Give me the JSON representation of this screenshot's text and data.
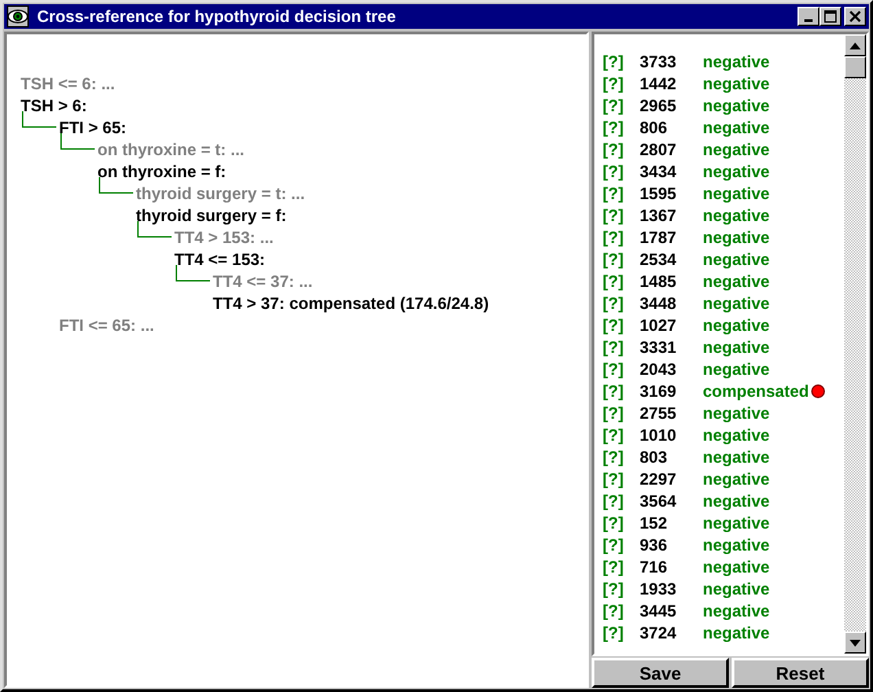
{
  "window": {
    "title": "Cross-reference for hypothyroid decision tree"
  },
  "tree": [
    {
      "text": "TSH <= 6: ...",
      "kind": "collapsed"
    },
    {
      "text": "TSH > 6:",
      "kind": "open",
      "children": [
        {
          "text": "FTI > 65:",
          "kind": "open",
          "children": [
            {
              "text": "on thyroxine = t: ...",
              "kind": "collapsed"
            },
            {
              "text": "on thyroxine = f:",
              "kind": "open",
              "children": [
                {
                  "text": "thyroid surgery = t: ...",
                  "kind": "collapsed"
                },
                {
                  "text": "thyroid surgery = f:",
                  "kind": "open",
                  "children": [
                    {
                      "text": "TT4 > 153: ...",
                      "kind": "collapsed"
                    },
                    {
                      "text": "TT4 <= 153:",
                      "kind": "open",
                      "children": [
                        {
                          "text": "TT4 <= 37: ...",
                          "kind": "collapsed"
                        },
                        {
                          "text": "TT4 > 37: compensated (174.6/24.8)",
                          "kind": "leaf"
                        }
                      ]
                    }
                  ]
                }
              ]
            }
          ]
        },
        {
          "text": "FTI <= 65: ...",
          "kind": "collapsed"
        }
      ]
    }
  ],
  "cases": [
    {
      "mark": "[?]",
      "id": "3733",
      "class": "negative",
      "flagged": false
    },
    {
      "mark": "[?]",
      "id": "1442",
      "class": "negative",
      "flagged": false
    },
    {
      "mark": "[?]",
      "id": "2965",
      "class": "negative",
      "flagged": false
    },
    {
      "mark": "[?]",
      "id": "806",
      "class": "negative",
      "flagged": false
    },
    {
      "mark": "[?]",
      "id": "2807",
      "class": "negative",
      "flagged": false
    },
    {
      "mark": "[?]",
      "id": "3434",
      "class": "negative",
      "flagged": false
    },
    {
      "mark": "[?]",
      "id": "1595",
      "class": "negative",
      "flagged": false
    },
    {
      "mark": "[?]",
      "id": "1367",
      "class": "negative",
      "flagged": false
    },
    {
      "mark": "[?]",
      "id": "1787",
      "class": "negative",
      "flagged": false
    },
    {
      "mark": "[?]",
      "id": "2534",
      "class": "negative",
      "flagged": false
    },
    {
      "mark": "[?]",
      "id": "1485",
      "class": "negative",
      "flagged": false
    },
    {
      "mark": "[?]",
      "id": "3448",
      "class": "negative",
      "flagged": false
    },
    {
      "mark": "[?]",
      "id": "1027",
      "class": "negative",
      "flagged": false
    },
    {
      "mark": "[?]",
      "id": "3331",
      "class": "negative",
      "flagged": false
    },
    {
      "mark": "[?]",
      "id": "2043",
      "class": "negative",
      "flagged": false
    },
    {
      "mark": "[?]",
      "id": "3169",
      "class": "compensated",
      "flagged": true
    },
    {
      "mark": "[?]",
      "id": "2755",
      "class": "negative",
      "flagged": false
    },
    {
      "mark": "[?]",
      "id": "1010",
      "class": "negative",
      "flagged": false
    },
    {
      "mark": "[?]",
      "id": "803",
      "class": "negative",
      "flagged": false
    },
    {
      "mark": "[?]",
      "id": "2297",
      "class": "negative",
      "flagged": false
    },
    {
      "mark": "[?]",
      "id": "3564",
      "class": "negative",
      "flagged": false
    },
    {
      "mark": "[?]",
      "id": "152",
      "class": "negative",
      "flagged": false
    },
    {
      "mark": "[?]",
      "id": "936",
      "class": "negative",
      "flagged": false
    },
    {
      "mark": "[?]",
      "id": "716",
      "class": "negative",
      "flagged": false
    },
    {
      "mark": "[?]",
      "id": "1933",
      "class": "negative",
      "flagged": false
    },
    {
      "mark": "[?]",
      "id": "3445",
      "class": "negative",
      "flagged": false
    },
    {
      "mark": "[?]",
      "id": "3724",
      "class": "negative",
      "flagged": false
    }
  ],
  "buttons": [
    "Save",
    "Reset"
  ]
}
